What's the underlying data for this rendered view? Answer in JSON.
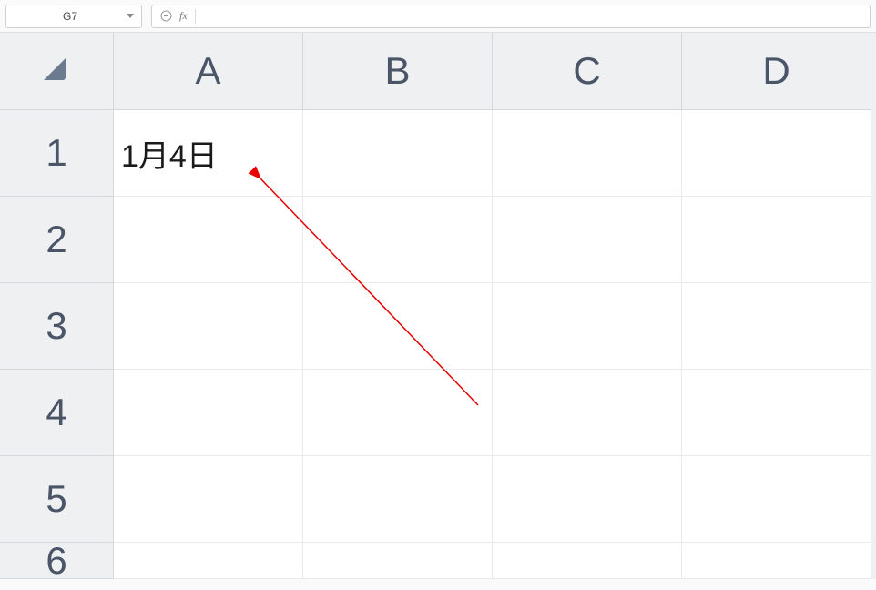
{
  "formula_bar": {
    "name_box_value": "G7",
    "fx_label": "fx",
    "formula_value": ""
  },
  "columns": [
    "A",
    "B",
    "C",
    "D"
  ],
  "rows": [
    "1",
    "2",
    "3",
    "4",
    "5",
    "6"
  ],
  "cells": {
    "A1": "1月4日"
  }
}
